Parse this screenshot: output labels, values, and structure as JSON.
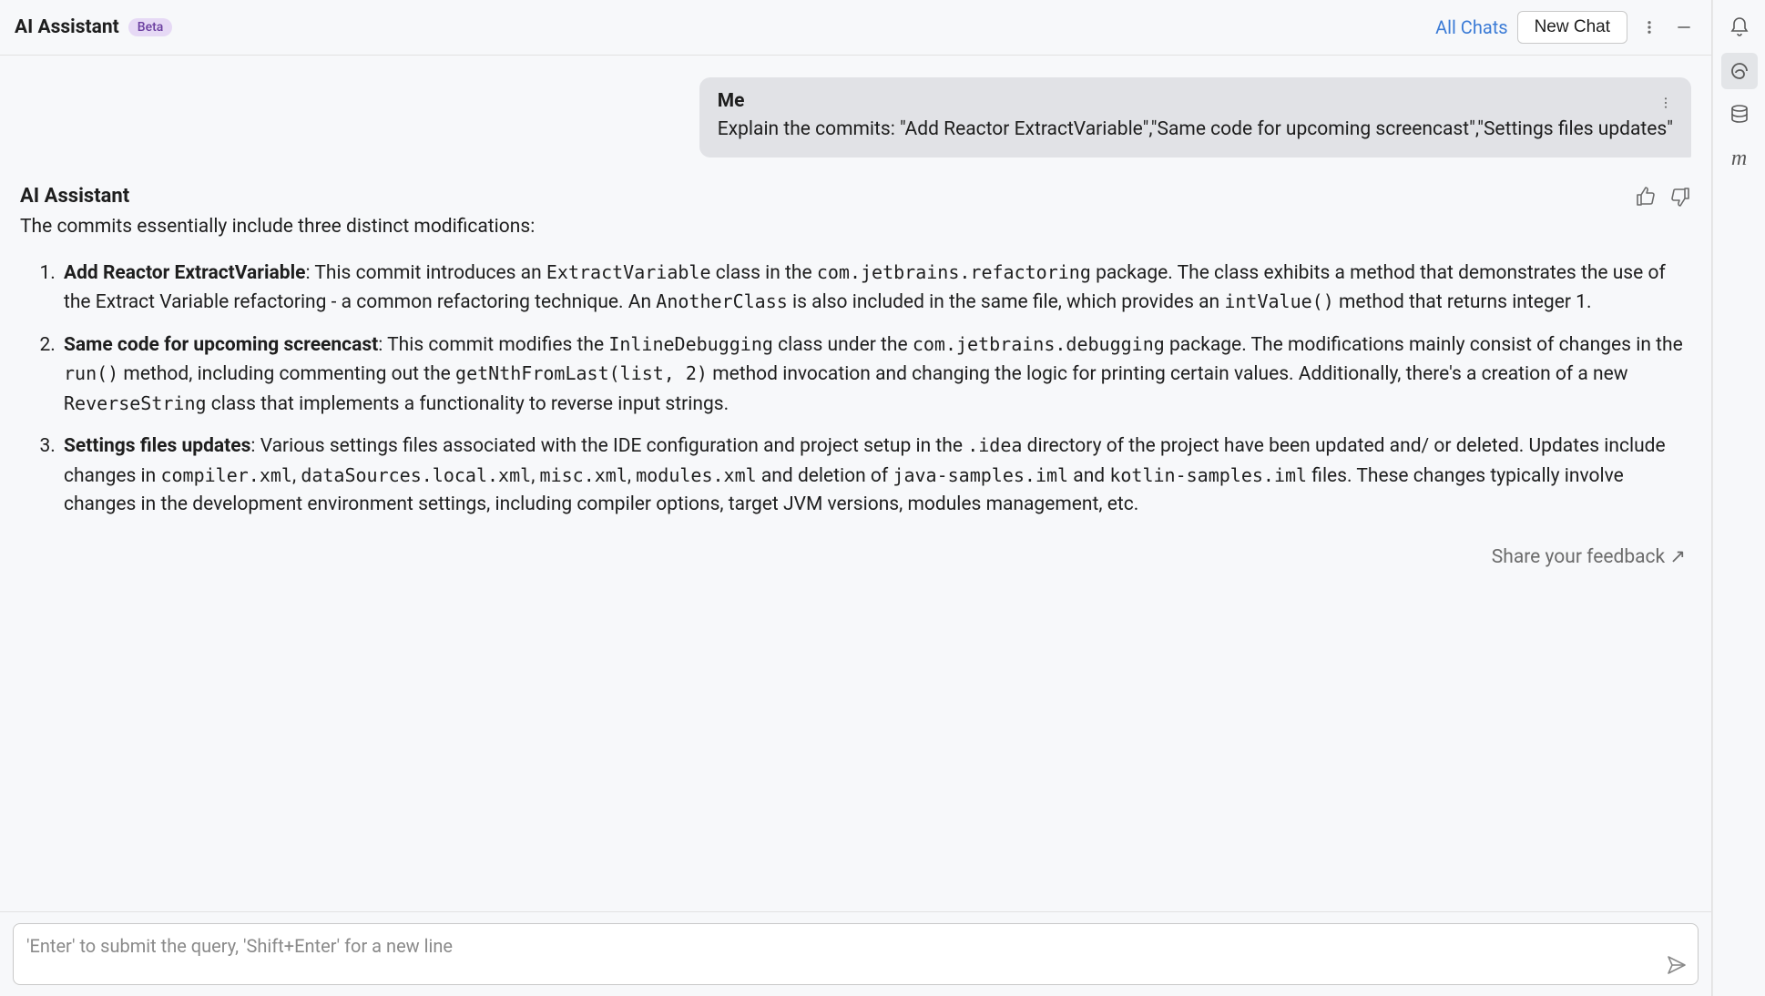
{
  "header": {
    "title": "AI Assistant",
    "badge": "Beta",
    "all_chats": "All Chats",
    "new_chat": "New Chat"
  },
  "user_message": {
    "sender": "Me",
    "text": "Explain the commits: \"Add Reactor ExtractVariable\",\"Same code for upcoming screencast\",\"Settings files updates\""
  },
  "assistant_message": {
    "sender": "AI Assistant",
    "intro": "The commits essentially include three distinct modifications:",
    "items": [
      {
        "title": "Add Reactor ExtractVariable",
        "seg1": ": This commit introduces an ",
        "code1": "ExtractVariable",
        "seg2": " class in the ",
        "code2": "com.jetbrains.refactoring",
        "seg3": " package. The class exhibits a method that demonstrates the use of the Extract Variable refactoring - a common refactoring technique. An ",
        "code3": "AnotherClass",
        "seg4": " is also included in the same file, which provides an ",
        "code4": "intValue()",
        "seg5": " method that returns integer 1."
      },
      {
        "title": "Same code for upcoming screencast",
        "seg1": ": This commit modifies the ",
        "code1": "InlineDebugging",
        "seg2": " class under the ",
        "code2": "com.jetbrains.debugging",
        "seg3": " package. The modifications mainly consist of changes in the ",
        "code3": "run()",
        "seg4": " method, including commenting out the ",
        "code4": "getNthFromLast(list, 2)",
        "seg5": " method invocation and changing the logic for printing certain values. Additionally, there's a creation of a new ",
        "code5": "ReverseString",
        "seg6": " class that implements a functionality to reverse input strings."
      },
      {
        "title": "Settings files updates",
        "seg1": ": Various settings files associated with the IDE configuration and project setup in the ",
        "code1": ".idea",
        "seg2": " directory of the project have been updated and/ or deleted. Updates include changes in ",
        "code2": "compiler.xml",
        "seg3": ", ",
        "code3": "dataSources.local.xml",
        "seg4": ", ",
        "code4": "misc.xml",
        "seg5": ", ",
        "code5": "modules.xml",
        "seg6": " and deletion of ",
        "code6": "java-samples.iml",
        "seg7": " and ",
        "code7": "kotlin-samples.iml",
        "seg8": " files. These changes typically involve changes in the development environment settings, including compiler options, target JVM versions, modules management, etc."
      }
    ]
  },
  "feedback_link": "Share your feedback ↗",
  "input_placeholder": "'Enter' to submit the query, 'Shift+Enter' for a new line",
  "right_rail_icons": [
    "bell-icon",
    "ai-swirl-icon",
    "database-icon",
    "m-icon"
  ]
}
